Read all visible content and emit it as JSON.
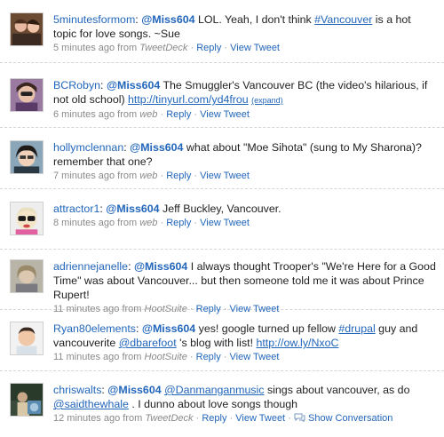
{
  "tweets": [
    {
      "user": "5minutesformom",
      "mention": "@Miss604",
      "t1": " LOL. Yeah, I don't think ",
      "hashtag": "#Vancouver",
      "t2": " is a hot topic for love songs. ~Sue",
      "time": "5 minutes ago from ",
      "source": "TweetDeck",
      "reply": "Reply",
      "view": "View Tweet"
    },
    {
      "user": "BCRobyn",
      "mention": "@Miss604",
      "t1": " The Smuggler's Vancouver BC (the video's hilarious, if not old school) ",
      "link": "http://tinyurl.com/yd4frou",
      "expand": "(expand)",
      "time": "6 minutes ago from ",
      "source": "web",
      "reply": "Reply",
      "view": "View Tweet"
    },
    {
      "user": "hollymclennan",
      "mention": "@Miss604",
      "t1": " what about \"Moe Sihota\" (sung to My Sharona)? remember that one?",
      "time": "7 minutes ago from ",
      "source": "web",
      "reply": "Reply",
      "view": "View Tweet"
    },
    {
      "user": "attractor1",
      "mention": "@Miss604",
      "t1": " Jeff Buckley, Vancouver.",
      "time": "8 minutes ago from ",
      "source": "web",
      "reply": "Reply",
      "view": "View Tweet"
    },
    {
      "user": "adriennejanelle",
      "mention": "@Miss604",
      "t1": " I always thought Trooper's \"We're Here for a Good Time\" was about Vancouver... but then someone told me it was about Prince Rupert!",
      "time": "11 minutes ago from ",
      "source": "HootSuite",
      "reply": "Reply",
      "view": "View Tweet"
    },
    {
      "user": "Ryan80elements",
      "mention": "@Miss604",
      "t1": " yes! google turned up fellow ",
      "hashtag": "#drupal",
      "t2": " guy and vancouverite ",
      "mention2": "@dbarefoot",
      "t3": " 's blog with list! ",
      "link": "http://ow.ly/NxoC",
      "time": "11 minutes ago from ",
      "source": "HootSuite",
      "reply": "Reply",
      "view": "View Tweet"
    },
    {
      "user": "chriswalts",
      "mention": "@Miss604",
      "t1": " ",
      "mention2": "@Danmanganmusic",
      "t2": " sings about vancouver, as do ",
      "mention3": "@saidthewhale",
      "t3": " . I dunno about love songs though",
      "time": "12 minutes ago from ",
      "source": "TweetDeck",
      "reply": "Reply",
      "view": "View Tweet",
      "conversation": "Show Conversation"
    }
  ],
  "separator": "·",
  "colon": ":",
  "icons": [
    "avatar",
    "conversation-icon"
  ],
  "colors": {
    "link": "#2266bb",
    "meta": "#8a8a8a",
    "divider": "#d6d6d6"
  }
}
